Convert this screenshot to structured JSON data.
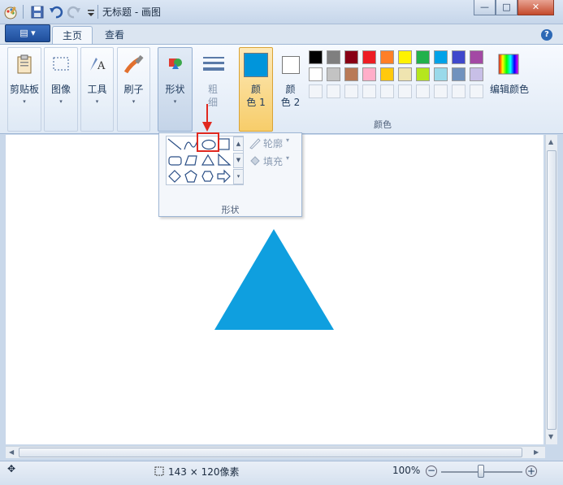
{
  "window": {
    "title": "无标题 - 画图",
    "minimize": "—",
    "maximize": "□",
    "close": "✕"
  },
  "ribbon_tabs": {
    "app_menu": "▤ ▾",
    "home": "主页",
    "view": "查看",
    "help": "?"
  },
  "groups": {
    "clipboard": "剪贴板",
    "image": "图像",
    "tools": "工具",
    "brushes": "刷子",
    "shapes": "形状",
    "size_line1": "粗",
    "size_line2": "细",
    "color1_line1": "颜",
    "color1_line2": "色 1",
    "color2_line1": "颜",
    "color2_line2": "色 2",
    "edit_colors": "编辑颜色",
    "colors_caption": "颜色",
    "dropdown": "▾"
  },
  "selected_colors": {
    "color1": "#0095db",
    "color2": "#ffffff"
  },
  "palette": {
    "row1": [
      "#000000",
      "#7f7f7f",
      "#880015",
      "#ed1c24",
      "#ff7f27",
      "#fff200",
      "#22b14c",
      "#00a2e8",
      "#3f48cc",
      "#a349a4"
    ],
    "row2": [
      "#ffffff",
      "#c3c3c3",
      "#b97a57",
      "#ffaec9",
      "#ffc90e",
      "#efe4b0",
      "#b5e61d",
      "#99d9ea",
      "#7092be",
      "#c8bfe7"
    ]
  },
  "shapes_popup": {
    "outline": "轮廓",
    "fill": "填充",
    "caption": "形状",
    "shapes": [
      "line-icon",
      "curve-icon",
      "oval-icon",
      "rectangle-icon",
      "rounded-rectangle-icon",
      "polygon-icon",
      "triangle-icon",
      "right-triangle-icon",
      "diamond-icon",
      "pentagon-icon",
      "hexagon-icon",
      "right-arrow-icon"
    ]
  },
  "canvas": {
    "triangle_color": "#0f9fdf"
  },
  "status": {
    "selection_size": "143 × 120像素",
    "zoom": "100%",
    "zoom_out": "−",
    "zoom_in": "+"
  }
}
